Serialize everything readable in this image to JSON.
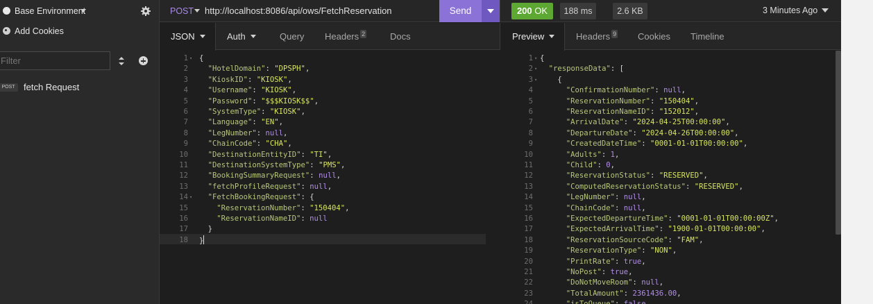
{
  "sidebar": {
    "environment": "Base Environment",
    "cookies": "Add Cookies",
    "filter_placeholder": "Filter",
    "request": {
      "method": "POST",
      "name": "fetch Request"
    }
  },
  "request_bar": {
    "method": "POST",
    "url": "http://localhost:8086/api/ows/FetchReservation",
    "send": "Send"
  },
  "response_bar": {
    "status_code": "200",
    "status_text": "OK",
    "time": "188 ms",
    "size": "2.6 KB",
    "when": "3 Minutes Ago"
  },
  "request_tabs": {
    "body": "JSON",
    "auth": "Auth",
    "query": "Query",
    "headers": "Headers",
    "headers_count": "2",
    "docs": "Docs"
  },
  "response_tabs": {
    "preview": "Preview",
    "headers": "Headers",
    "headers_count": "9",
    "cookies": "Cookies",
    "timeline": "Timeline"
  },
  "request_body": [
    {
      "n": "1",
      "fold": true,
      "i": 0,
      "t": [
        [
          "p",
          "{"
        ]
      ]
    },
    {
      "n": "2",
      "i": 1,
      "t": [
        [
          "key",
          "\"HotelDomain\""
        ],
        [
          "p",
          ": "
        ],
        [
          "str",
          "\"DPSPH\""
        ],
        [
          "p",
          ","
        ]
      ]
    },
    {
      "n": "3",
      "i": 1,
      "t": [
        [
          "key",
          "\"KioskID\""
        ],
        [
          "p",
          ": "
        ],
        [
          "str",
          "\"KIOSK\""
        ],
        [
          "p",
          ","
        ]
      ]
    },
    {
      "n": "4",
      "i": 1,
      "t": [
        [
          "key",
          "\"Username\""
        ],
        [
          "p",
          ": "
        ],
        [
          "str",
          "\"KIOSK\""
        ],
        [
          "p",
          ","
        ]
      ]
    },
    {
      "n": "5",
      "i": 1,
      "t": [
        [
          "key",
          "\"Password\""
        ],
        [
          "p",
          ": "
        ],
        [
          "str",
          "\"$$$KIOSK$$\""
        ],
        [
          "p",
          ","
        ]
      ]
    },
    {
      "n": "6",
      "i": 1,
      "t": [
        [
          "key",
          "\"SystemType\""
        ],
        [
          "p",
          ": "
        ],
        [
          "str",
          "\"KIOSK\""
        ],
        [
          "p",
          ","
        ]
      ]
    },
    {
      "n": "7",
      "i": 1,
      "t": [
        [
          "key",
          "\"Language\""
        ],
        [
          "p",
          ": "
        ],
        [
          "str",
          "\"EN\""
        ],
        [
          "p",
          ","
        ]
      ]
    },
    {
      "n": "8",
      "i": 1,
      "t": [
        [
          "key",
          "\"LegNumber\""
        ],
        [
          "p",
          ": "
        ],
        [
          "kw",
          "null"
        ],
        [
          "p",
          ","
        ]
      ]
    },
    {
      "n": "9",
      "i": 1,
      "t": [
        [
          "key",
          "\"ChainCode\""
        ],
        [
          "p",
          ": "
        ],
        [
          "str",
          "\"CHA\""
        ],
        [
          "p",
          ","
        ]
      ]
    },
    {
      "n": "10",
      "i": 1,
      "t": [
        [
          "key",
          "\"DestinationEntityID\""
        ],
        [
          "p",
          ": "
        ],
        [
          "str",
          "\"TI\""
        ],
        [
          "p",
          ","
        ]
      ]
    },
    {
      "n": "11",
      "i": 1,
      "t": [
        [
          "key",
          "\"DestinationSystemType\""
        ],
        [
          "p",
          ": "
        ],
        [
          "str",
          "\"PMS\""
        ],
        [
          "p",
          ","
        ]
      ]
    },
    {
      "n": "12",
      "i": 1,
      "t": [
        [
          "key",
          "\"BookingSummaryRequest\""
        ],
        [
          "p",
          ": "
        ],
        [
          "kw",
          "null"
        ],
        [
          "p",
          ","
        ]
      ]
    },
    {
      "n": "13",
      "i": 1,
      "t": [
        [
          "key",
          "\"fetchProfileRequest\""
        ],
        [
          "p",
          ": "
        ],
        [
          "kw",
          "null"
        ],
        [
          "p",
          ","
        ]
      ]
    },
    {
      "n": "14",
      "fold": true,
      "i": 1,
      "t": [
        [
          "key",
          "\"FetchBookingRequest\""
        ],
        [
          "p",
          ": {"
        ]
      ]
    },
    {
      "n": "15",
      "i": 2,
      "t": [
        [
          "key",
          "\"ReservationNumber\""
        ],
        [
          "p",
          ": "
        ],
        [
          "str",
          "\"150404\""
        ],
        [
          "p",
          ","
        ]
      ]
    },
    {
      "n": "16",
      "i": 2,
      "t": [
        [
          "key",
          "\"ReservationNameID\""
        ],
        [
          "p",
          ": "
        ],
        [
          "kw",
          "null"
        ]
      ]
    },
    {
      "n": "17",
      "i": 1,
      "t": [
        [
          "p",
          "}"
        ]
      ]
    },
    {
      "n": "18",
      "i": 0,
      "t": [
        [
          "p",
          "}"
        ]
      ]
    }
  ],
  "response_body": [
    {
      "n": "1",
      "fold": true,
      "i": 0,
      "t": [
        [
          "p",
          "{"
        ]
      ]
    },
    {
      "n": "2",
      "fold": true,
      "i": 1,
      "t": [
        [
          "key",
          "\"responseData\""
        ],
        [
          "p",
          ": ["
        ]
      ]
    },
    {
      "n": "3",
      "fold": true,
      "i": 2,
      "t": [
        [
          "p",
          "{"
        ]
      ]
    },
    {
      "n": "4",
      "i": 3,
      "t": [
        [
          "key",
          "\"ConfirmationNumber\""
        ],
        [
          "p",
          ": "
        ],
        [
          "kw",
          "null"
        ],
        [
          "p",
          ","
        ]
      ]
    },
    {
      "n": "5",
      "i": 3,
      "t": [
        [
          "key",
          "\"ReservationNumber\""
        ],
        [
          "p",
          ": "
        ],
        [
          "str",
          "\"150404\""
        ],
        [
          "p",
          ","
        ]
      ]
    },
    {
      "n": "6",
      "i": 3,
      "t": [
        [
          "key",
          "\"ReservationNameID\""
        ],
        [
          "p",
          ": "
        ],
        [
          "str",
          "\"152012\""
        ],
        [
          "p",
          ","
        ]
      ]
    },
    {
      "n": "7",
      "i": 3,
      "t": [
        [
          "key",
          "\"ArrivalDate\""
        ],
        [
          "p",
          ": "
        ],
        [
          "str",
          "\"2024-04-25T00:00:00\""
        ],
        [
          "p",
          ","
        ]
      ]
    },
    {
      "n": "8",
      "i": 3,
      "t": [
        [
          "key",
          "\"DepartureDate\""
        ],
        [
          "p",
          ": "
        ],
        [
          "str",
          "\"2024-04-26T00:00:00\""
        ],
        [
          "p",
          ","
        ]
      ]
    },
    {
      "n": "9",
      "i": 3,
      "t": [
        [
          "key",
          "\"CreatedDateTime\""
        ],
        [
          "p",
          ": "
        ],
        [
          "str",
          "\"0001-01-01T00:00:00\""
        ],
        [
          "p",
          ","
        ]
      ]
    },
    {
      "n": "10",
      "i": 3,
      "t": [
        [
          "key",
          "\"Adults\""
        ],
        [
          "p",
          ": "
        ],
        [
          "num",
          "1"
        ],
        [
          "p",
          ","
        ]
      ]
    },
    {
      "n": "11",
      "i": 3,
      "t": [
        [
          "key",
          "\"Child\""
        ],
        [
          "p",
          ": "
        ],
        [
          "num",
          "0"
        ],
        [
          "p",
          ","
        ]
      ]
    },
    {
      "n": "12",
      "i": 3,
      "t": [
        [
          "key",
          "\"ReservationStatus\""
        ],
        [
          "p",
          ": "
        ],
        [
          "str",
          "\"RESERVED\""
        ],
        [
          "p",
          ","
        ]
      ]
    },
    {
      "n": "13",
      "i": 3,
      "t": [
        [
          "key",
          "\"ComputedReservationStatus\""
        ],
        [
          "p",
          ": "
        ],
        [
          "str",
          "\"RESERVED\""
        ],
        [
          "p",
          ","
        ]
      ]
    },
    {
      "n": "14",
      "i": 3,
      "t": [
        [
          "key",
          "\"LegNumber\""
        ],
        [
          "p",
          ": "
        ],
        [
          "kw",
          "null"
        ],
        [
          "p",
          ","
        ]
      ]
    },
    {
      "n": "15",
      "i": 3,
      "t": [
        [
          "key",
          "\"ChainCode\""
        ],
        [
          "p",
          ": "
        ],
        [
          "kw",
          "null"
        ],
        [
          "p",
          ","
        ]
      ]
    },
    {
      "n": "16",
      "i": 3,
      "t": [
        [
          "key",
          "\"ExpectedDepartureTime\""
        ],
        [
          "p",
          ": "
        ],
        [
          "str",
          "\"0001-01-01T00:00:00Z\""
        ],
        [
          "p",
          ","
        ]
      ]
    },
    {
      "n": "17",
      "i": 3,
      "t": [
        [
          "key",
          "\"ExpectedArrivalTime\""
        ],
        [
          "p",
          ": "
        ],
        [
          "str",
          "\"1900-01-01T00:00:00\""
        ],
        [
          "p",
          ","
        ]
      ]
    },
    {
      "n": "18",
      "i": 3,
      "t": [
        [
          "key",
          "\"ReservationSourceCode\""
        ],
        [
          "p",
          ": "
        ],
        [
          "str",
          "\"FAM\""
        ],
        [
          "p",
          ","
        ]
      ]
    },
    {
      "n": "19",
      "i": 3,
      "t": [
        [
          "key",
          "\"ReservationType\""
        ],
        [
          "p",
          ": "
        ],
        [
          "str",
          "\"NON\""
        ],
        [
          "p",
          ","
        ]
      ]
    },
    {
      "n": "20",
      "i": 3,
      "t": [
        [
          "key",
          "\"PrintRate\""
        ],
        [
          "p",
          ": "
        ],
        [
          "kw",
          "true"
        ],
        [
          "p",
          ","
        ]
      ]
    },
    {
      "n": "21",
      "i": 3,
      "t": [
        [
          "key",
          "\"NoPost\""
        ],
        [
          "p",
          ": "
        ],
        [
          "kw",
          "true"
        ],
        [
          "p",
          ","
        ]
      ]
    },
    {
      "n": "22",
      "i": 3,
      "t": [
        [
          "key",
          "\"DoNotMoveRoom\""
        ],
        [
          "p",
          ": "
        ],
        [
          "kw",
          "null"
        ],
        [
          "p",
          ","
        ]
      ]
    },
    {
      "n": "23",
      "i": 3,
      "t": [
        [
          "key",
          "\"TotalAmount\""
        ],
        [
          "p",
          ": "
        ],
        [
          "num",
          "2361436.00"
        ],
        [
          "p",
          ","
        ]
      ]
    },
    {
      "n": "24",
      "i": 3,
      "t": [
        [
          "key",
          "\"isToQueue\""
        ],
        [
          "p",
          ": "
        ],
        [
          "kw",
          "false"
        ]
      ]
    }
  ]
}
